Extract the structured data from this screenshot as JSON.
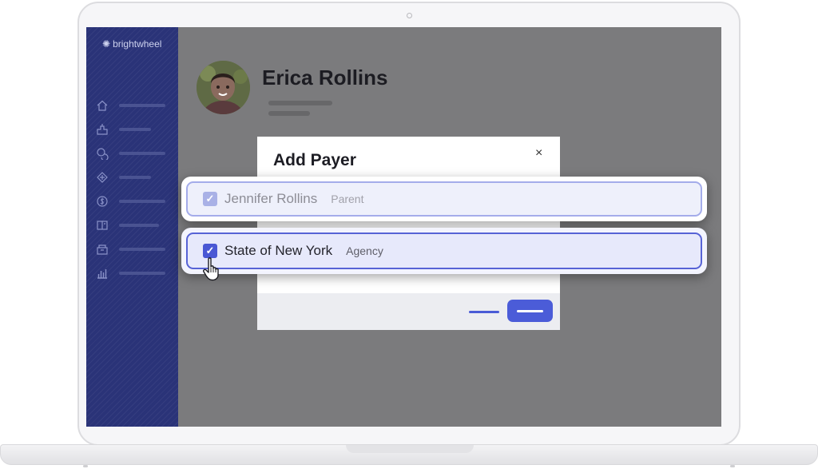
{
  "app": {
    "logo_text": "brightwheel",
    "logo_icon": "sun-dots-icon"
  },
  "sidebar": {
    "items": [
      {
        "icon": "home-icon"
      },
      {
        "icon": "classroom-icon"
      },
      {
        "icon": "messages-icon"
      },
      {
        "icon": "activities-icon"
      },
      {
        "icon": "billing-icon"
      },
      {
        "icon": "learning-icon"
      },
      {
        "icon": "paperwork-icon"
      },
      {
        "icon": "reports-icon"
      }
    ]
  },
  "profile": {
    "name": "Erica Rollins"
  },
  "modal": {
    "title": "Add Payer",
    "close_label": "×",
    "payers": [
      {
        "name": "Jennifer Rollins",
        "type": "Parent",
        "checked": true,
        "state": "disabled"
      },
      {
        "name": "State of New York",
        "type": "Agency",
        "checked": true,
        "state": "active"
      }
    ]
  },
  "colors": {
    "sidebar": "#2a3378",
    "accent": "#4b5cd8",
    "overlay": "#7b7b7d"
  }
}
